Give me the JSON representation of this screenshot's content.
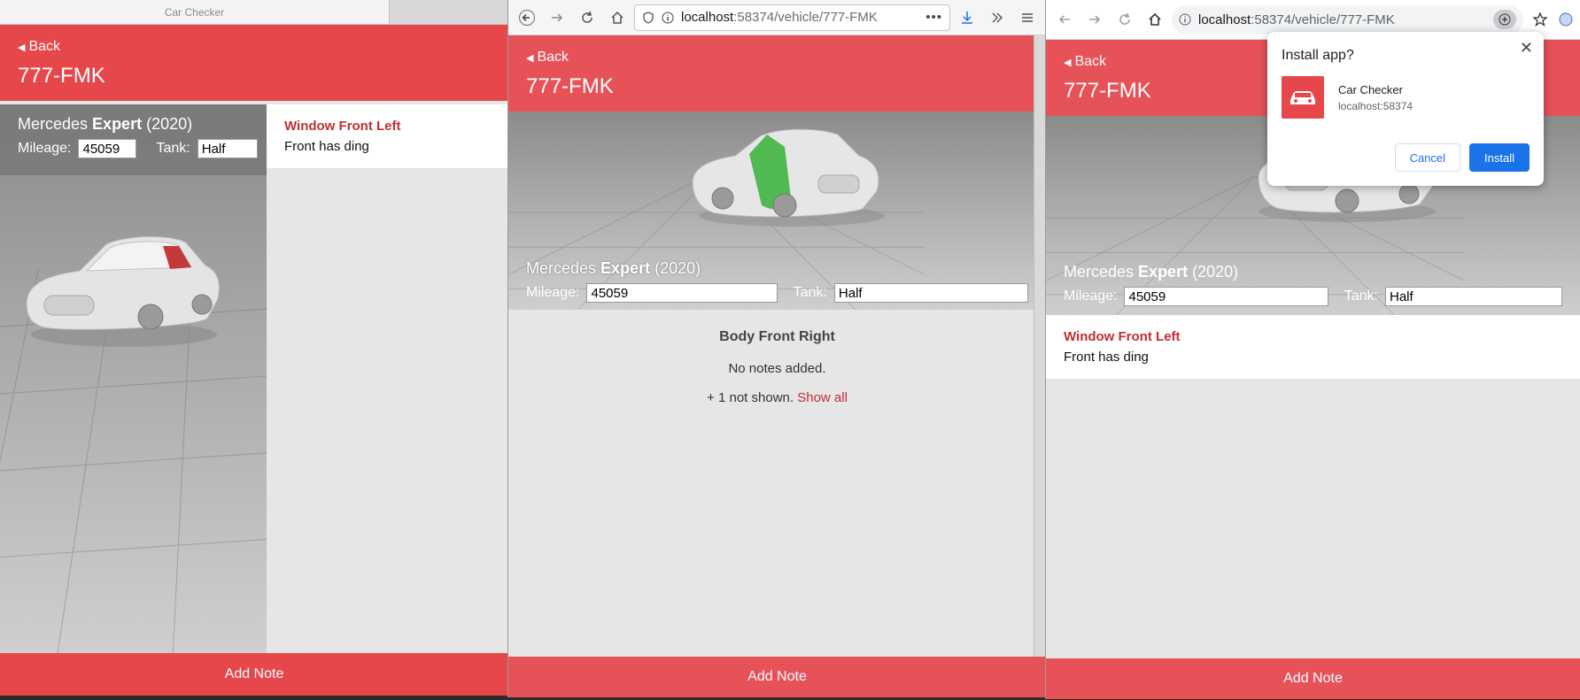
{
  "app": {
    "window_title": "Car Checker",
    "back_label": "Back",
    "plate": "777-FMK",
    "vehicle_make": "Mercedes",
    "vehicle_model": "Expert",
    "vehicle_year": "(2020)",
    "mileage_label": "Mileage:",
    "mileage_value": "45059",
    "tank_label": "Tank:",
    "tank_value": "Half",
    "add_note_label": "Add Note"
  },
  "note": {
    "location": "Window Front Left",
    "text": "Front has ding"
  },
  "firefox": {
    "url_host": "localhost",
    "url_path": ":58374/vehicle/777-FMK",
    "section_title": "Body Front Right",
    "empty_text": "No notes added.",
    "not_shown_text": "+ 1 not shown.",
    "show_all_label": "Show all"
  },
  "chrome": {
    "url_host": "localhost",
    "url_path": ":58374/vehicle/777-FMK",
    "install_title": "Install app?",
    "install_app_name": "Car Checker",
    "install_app_host": "localhost:58374",
    "cancel_label": "Cancel",
    "install_label": "Install"
  },
  "colors": {
    "brand_red": "#e6474b",
    "note_title_red": "#c22d32",
    "highlight_red": "#c43a3a",
    "highlight_green": "#3fb441",
    "install_blue": "#1a73e8"
  }
}
